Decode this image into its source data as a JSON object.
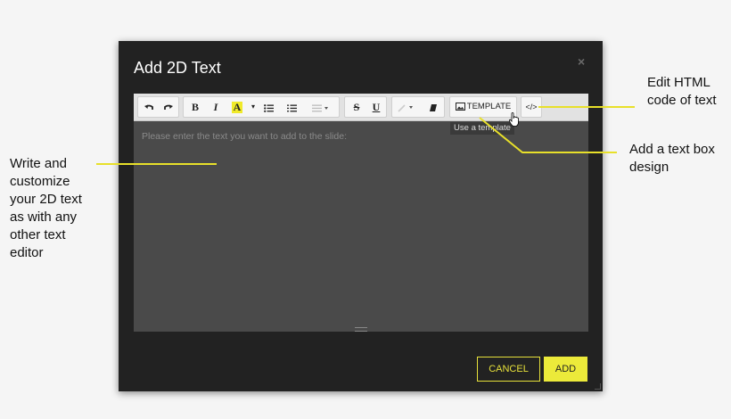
{
  "annotations": {
    "write": "Write and customize your 2D text as with any other text editor",
    "edit_html": "Edit HTML code of text",
    "text_box": "Add a text box design"
  },
  "dialog": {
    "title": "Add 2D Text",
    "close_glyph": "×",
    "editor_placeholder": "Please enter the text you want to add to the slide:",
    "tooltip": "Use a template",
    "cancel_label": "CANCEL",
    "add_label": "ADD"
  },
  "toolbar": {
    "bold_label": "B",
    "italic_label": "I",
    "font_color_label": "A",
    "strike_label": "S",
    "underline_label": "U",
    "template_label": "TEMPLATE",
    "code_label": "</>",
    "icons": [
      "undo-icon",
      "redo-icon",
      "bold-icon",
      "italic-icon",
      "font-color-icon",
      "bullet-list-icon",
      "numbered-list-icon",
      "align-icon",
      "strikethrough-icon",
      "underline-icon",
      "link-icon",
      "eraser-icon",
      "image-icon",
      "code-icon"
    ]
  },
  "colors": {
    "dialog_bg": "#222222",
    "editor_bg": "#4a4a4a",
    "accent_yellow": "#ecea3a",
    "page_bg": "#f5f5f5"
  }
}
